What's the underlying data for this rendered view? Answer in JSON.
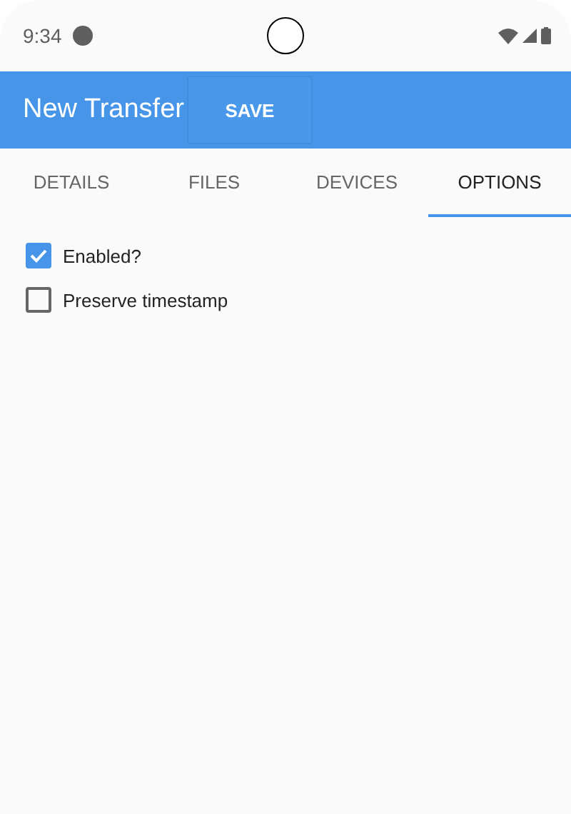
{
  "status_bar": {
    "time": "9:34"
  },
  "app_bar": {
    "title": "New Transfer",
    "action": "SAVE"
  },
  "tabs": [
    {
      "label": "DETAILS",
      "selected": false
    },
    {
      "label": "FILES",
      "selected": false
    },
    {
      "label": "DEVICES",
      "selected": false
    },
    {
      "label": "OPTIONS",
      "selected": true
    }
  ],
  "options": [
    {
      "label": "Enabled?",
      "checked": true
    },
    {
      "label": "Preserve timestamp",
      "checked": false
    }
  ]
}
